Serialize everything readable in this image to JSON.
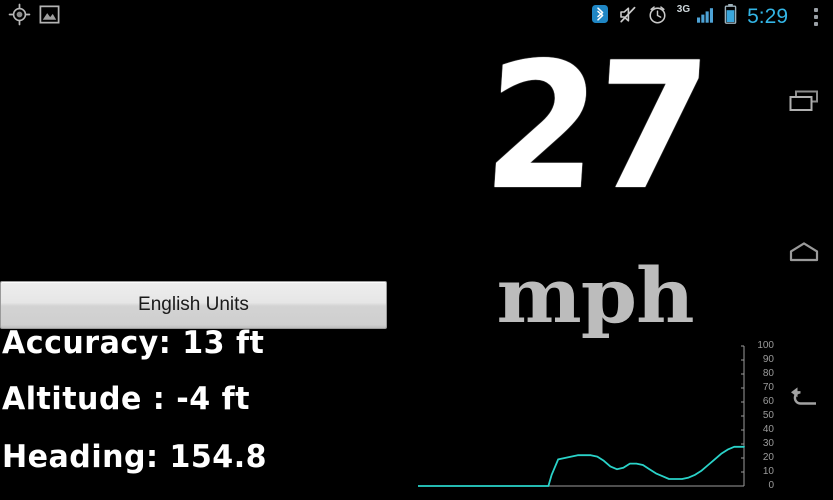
{
  "status_bar": {
    "left_icons": [
      {
        "name": "gps-location-icon",
        "label": "GPS location active"
      },
      {
        "name": "photo-gallery-icon",
        "label": "Screenshot captured"
      }
    ],
    "right_icons": [
      {
        "name": "bluetooth-icon",
        "label": "Bluetooth on",
        "color": "#33b5e5"
      },
      {
        "name": "mute-icon",
        "label": "Ringer muted"
      },
      {
        "name": "alarm-clock-icon",
        "label": "Alarm set"
      },
      {
        "name": "signal-3g-icon",
        "label": "3G"
      },
      {
        "name": "battery-icon",
        "label": "Battery"
      }
    ],
    "network_label": "3G",
    "clock": "5:29",
    "overflow_icon": "overflow-menu-icon",
    "accent_color": "#33b5e5"
  },
  "speed": {
    "value": "27",
    "unit": "mph",
    "value_color": "#ffffff",
    "unit_color": "#bcbcbc"
  },
  "units_button": {
    "label": "English Units"
  },
  "stats": [
    {
      "name": "accuracy",
      "text": "Accuracy: 13 ft"
    },
    {
      "name": "altitude",
      "text": "Altitude : -4 ft"
    },
    {
      "name": "heading",
      "text": "Heading: 154.8"
    }
  ],
  "nav_keys": [
    {
      "name": "recent-apps-icon",
      "label": "Recent apps"
    },
    {
      "name": "home-icon",
      "label": "Home"
    },
    {
      "name": "back-icon",
      "label": "Back"
    }
  ],
  "chart_data": {
    "type": "line",
    "title": "",
    "xlabel": "",
    "ylabel": "",
    "line_color": "#2ad3c9",
    "axis_color": "#9b9b9b",
    "grid": false,
    "ylim": [
      0,
      100
    ],
    "yticks": [
      100,
      90,
      80,
      70,
      60,
      50,
      40,
      30,
      20,
      10,
      0
    ],
    "ytick_labels": [
      "100",
      "90",
      "80",
      "70",
      "60",
      "50",
      "40",
      "30",
      "20",
      "10",
      "0"
    ],
    "series": [
      {
        "name": "speed-history-mph",
        "x": [
          0,
          5,
          10,
          15,
          20,
          25,
          30,
          35,
          38,
          40,
          41,
          43,
          45,
          47,
          49,
          51,
          53,
          55,
          57,
          59,
          61,
          63,
          65,
          67,
          69,
          71,
          73,
          75,
          77,
          79,
          81,
          83,
          85,
          87,
          89,
          91,
          93,
          95,
          97,
          100
        ],
        "values": [
          0,
          0,
          0,
          0,
          0,
          0,
          0,
          0,
          0,
          0,
          8,
          19,
          20,
          21,
          22,
          22,
          22,
          21,
          18,
          14,
          12,
          13,
          16,
          16,
          15,
          12,
          9,
          7,
          5,
          5,
          5,
          6,
          8,
          11,
          15,
          19,
          23,
          26,
          28,
          28
        ]
      }
    ]
  }
}
